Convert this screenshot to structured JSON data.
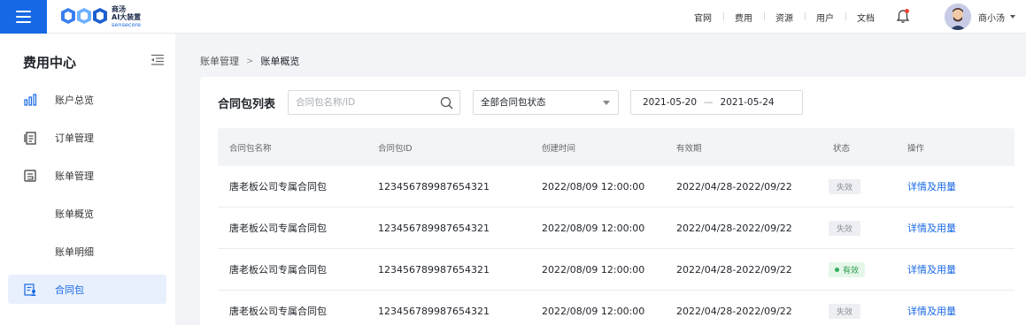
{
  "header": {
    "logo": {
      "line1": "商汤",
      "line2": "AI大装置",
      "line3": "sensecore"
    },
    "nav": [
      "官网",
      "费用",
      "资源",
      "用户",
      "文档"
    ],
    "user_name": "商小汤"
  },
  "sidebar": {
    "title": "费用中心",
    "items": [
      {
        "label": "账户总览",
        "icon": "bar-chart-icon"
      },
      {
        "label": "订单管理",
        "icon": "order-document-icon"
      },
      {
        "label": "账单管理",
        "icon": "bill-icon"
      },
      {
        "label": "账单概览"
      },
      {
        "label": "账单明细"
      },
      {
        "label": "合同包",
        "icon": "contract-user-icon",
        "active": true
      }
    ]
  },
  "breadcrumb": {
    "parent": "账单管理",
    "current": "账单概览"
  },
  "card": {
    "title": "合同包列表",
    "search_placeholder": "合同包名称/ID",
    "status_select": "全部合同包状态",
    "date_start": "2021-05-20",
    "date_end": "2021-05-24"
  },
  "table": {
    "headers": [
      "合同包名称",
      "合同包ID",
      "创建时间",
      "有效期",
      "状态",
      "操作"
    ],
    "rows": [
      {
        "name": "唐老板公司专属合同包",
        "id": "123456789987654321",
        "created": "2022/08/09 12:00:00",
        "period": "2022/04/28-2022/09/22",
        "status": "失效",
        "action": "详情及用量"
      },
      {
        "name": "唐老板公司专属合同包",
        "id": "123456789987654321",
        "created": "2022/08/09 12:00:00",
        "period": "2022/04/28-2022/09/22",
        "status": "失效",
        "action": "详情及用量"
      },
      {
        "name": "唐老板公司专属合同包",
        "id": "123456789987654321",
        "created": "2022/08/09 12:00:00",
        "period": "2022/04/28-2022/09/22",
        "status": "有效",
        "action": "详情及用量"
      },
      {
        "name": "唐老板公司专属合同包",
        "id": "123456789987654321",
        "created": "2022/08/09 12:00:00",
        "period": "2022/04/28-2022/09/22",
        "status": "失效",
        "action": "详情及用量"
      }
    ]
  },
  "colors": {
    "primary": "#1768e4",
    "valid": "#2fb15a",
    "invalid_bg": "#eeeff2",
    "notification": "#f04134"
  }
}
